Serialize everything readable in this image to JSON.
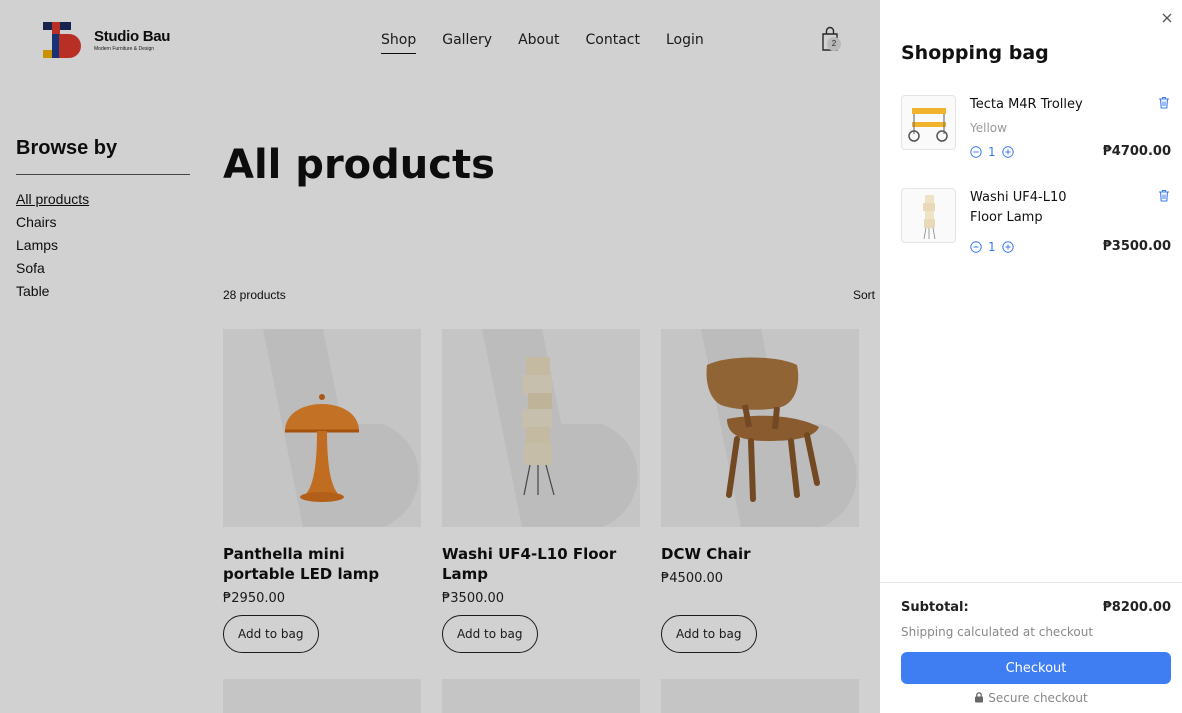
{
  "brand": {
    "name": "Studio Bau",
    "tagline": "Modern Furniture & Design",
    "logo_icon": "studio-bau-logo",
    "colors": {
      "red": "#e13b2e",
      "blue": "#1e3f8f",
      "navy": "#1b2c5e",
      "yellow": "#f4b300"
    }
  },
  "nav": {
    "items": [
      {
        "label": "Shop",
        "active": true
      },
      {
        "label": "Gallery"
      },
      {
        "label": "About"
      },
      {
        "label": "Contact"
      },
      {
        "label": "Login"
      }
    ],
    "bag_icon": "shopping-bag-icon",
    "bag_count": "2"
  },
  "sidebar": {
    "title": "Browse by",
    "items": [
      {
        "label": "All products",
        "active": true
      },
      {
        "label": "Chairs"
      },
      {
        "label": "Lamps"
      },
      {
        "label": "Sofa"
      },
      {
        "label": "Table"
      }
    ]
  },
  "main": {
    "title": "All products",
    "count": "28 products",
    "sort_label": "Sort",
    "products": [
      {
        "name": "Panthella mini portable LED lamp",
        "price": "₱2950.00",
        "add_label": "Add to bag",
        "image": "orange-mushroom-lamp"
      },
      {
        "name": "Washi UF4-L10 Floor Lamp",
        "price": "₱3500.00",
        "add_label": "Add to bag",
        "image": "paper-floor-lamp"
      },
      {
        "name": "DCW Chair",
        "price": "₱4500.00",
        "add_label": "Add to bag",
        "image": "plywood-lounge-chair"
      }
    ]
  },
  "drawer": {
    "close_icon": "close-icon",
    "title": "Shopping bag",
    "items": [
      {
        "name": "Tecta M4R Trolley",
        "variant": "Yellow",
        "qty": "1",
        "price": "₱4700.00",
        "image": "yellow-trolley"
      },
      {
        "name": "Washi UF4-L10 Floor Lamp",
        "qty": "1",
        "price": "₱3500.00",
        "image": "paper-floor-lamp"
      }
    ],
    "subtotal_label": "Subtotal:",
    "subtotal_value": "₱8200.00",
    "shipping_note": "Shipping calculated at checkout",
    "checkout_label": "Checkout",
    "secure_label": "Secure checkout",
    "accent": "#3f7ef2"
  }
}
